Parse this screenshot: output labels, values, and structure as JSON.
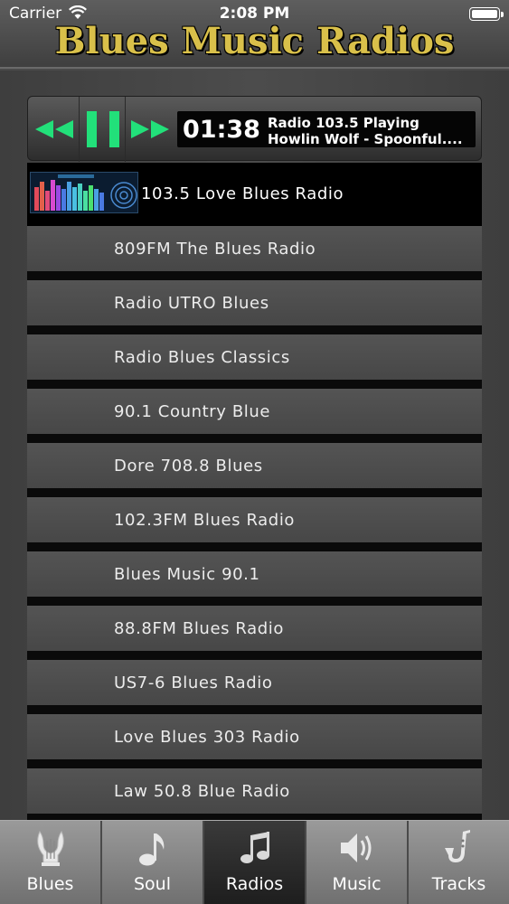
{
  "status": {
    "carrier": "Carrier",
    "time": "2:08 PM"
  },
  "header": {
    "title": "Blues Music Radios"
  },
  "player": {
    "elapsed": "01:38",
    "now_playing_line1": "Radio 103.5  Playing",
    "now_playing_line2": "Howlin Wolf - Spoonful...."
  },
  "stations": [
    {
      "label": "103.5 Love Blues Radio",
      "active": true
    },
    {
      "label": "809FM The Blues Radio"
    },
    {
      "label": "Radio UTRO Blues"
    },
    {
      "label": "Radio Blues Classics"
    },
    {
      "label": "90.1 Country Blue"
    },
    {
      "label": "Dore 708.8 Blues"
    },
    {
      "label": "102.3FM Blues Radio"
    },
    {
      "label": "Blues Music 90.1"
    },
    {
      "label": "88.8FM Blues Radio"
    },
    {
      "label": "US7-6 Blues Radio"
    },
    {
      "label": "Love Blues 303 Radio"
    },
    {
      "label": "Law 50.8 Blue Radio"
    }
  ],
  "tabs": [
    {
      "label": "Blues",
      "icon": "lyre-icon"
    },
    {
      "label": "Soul",
      "icon": "music-note-icon"
    },
    {
      "label": "Radios",
      "icon": "double-note-icon",
      "selected": true
    },
    {
      "label": "Music",
      "icon": "speaker-icon"
    },
    {
      "label": "Tracks",
      "icon": "saxophone-icon"
    }
  ],
  "colors": {
    "accent_green": "#22e07a",
    "title_gold": "#d9c04a",
    "selected_tab": "#1e1e1e"
  }
}
